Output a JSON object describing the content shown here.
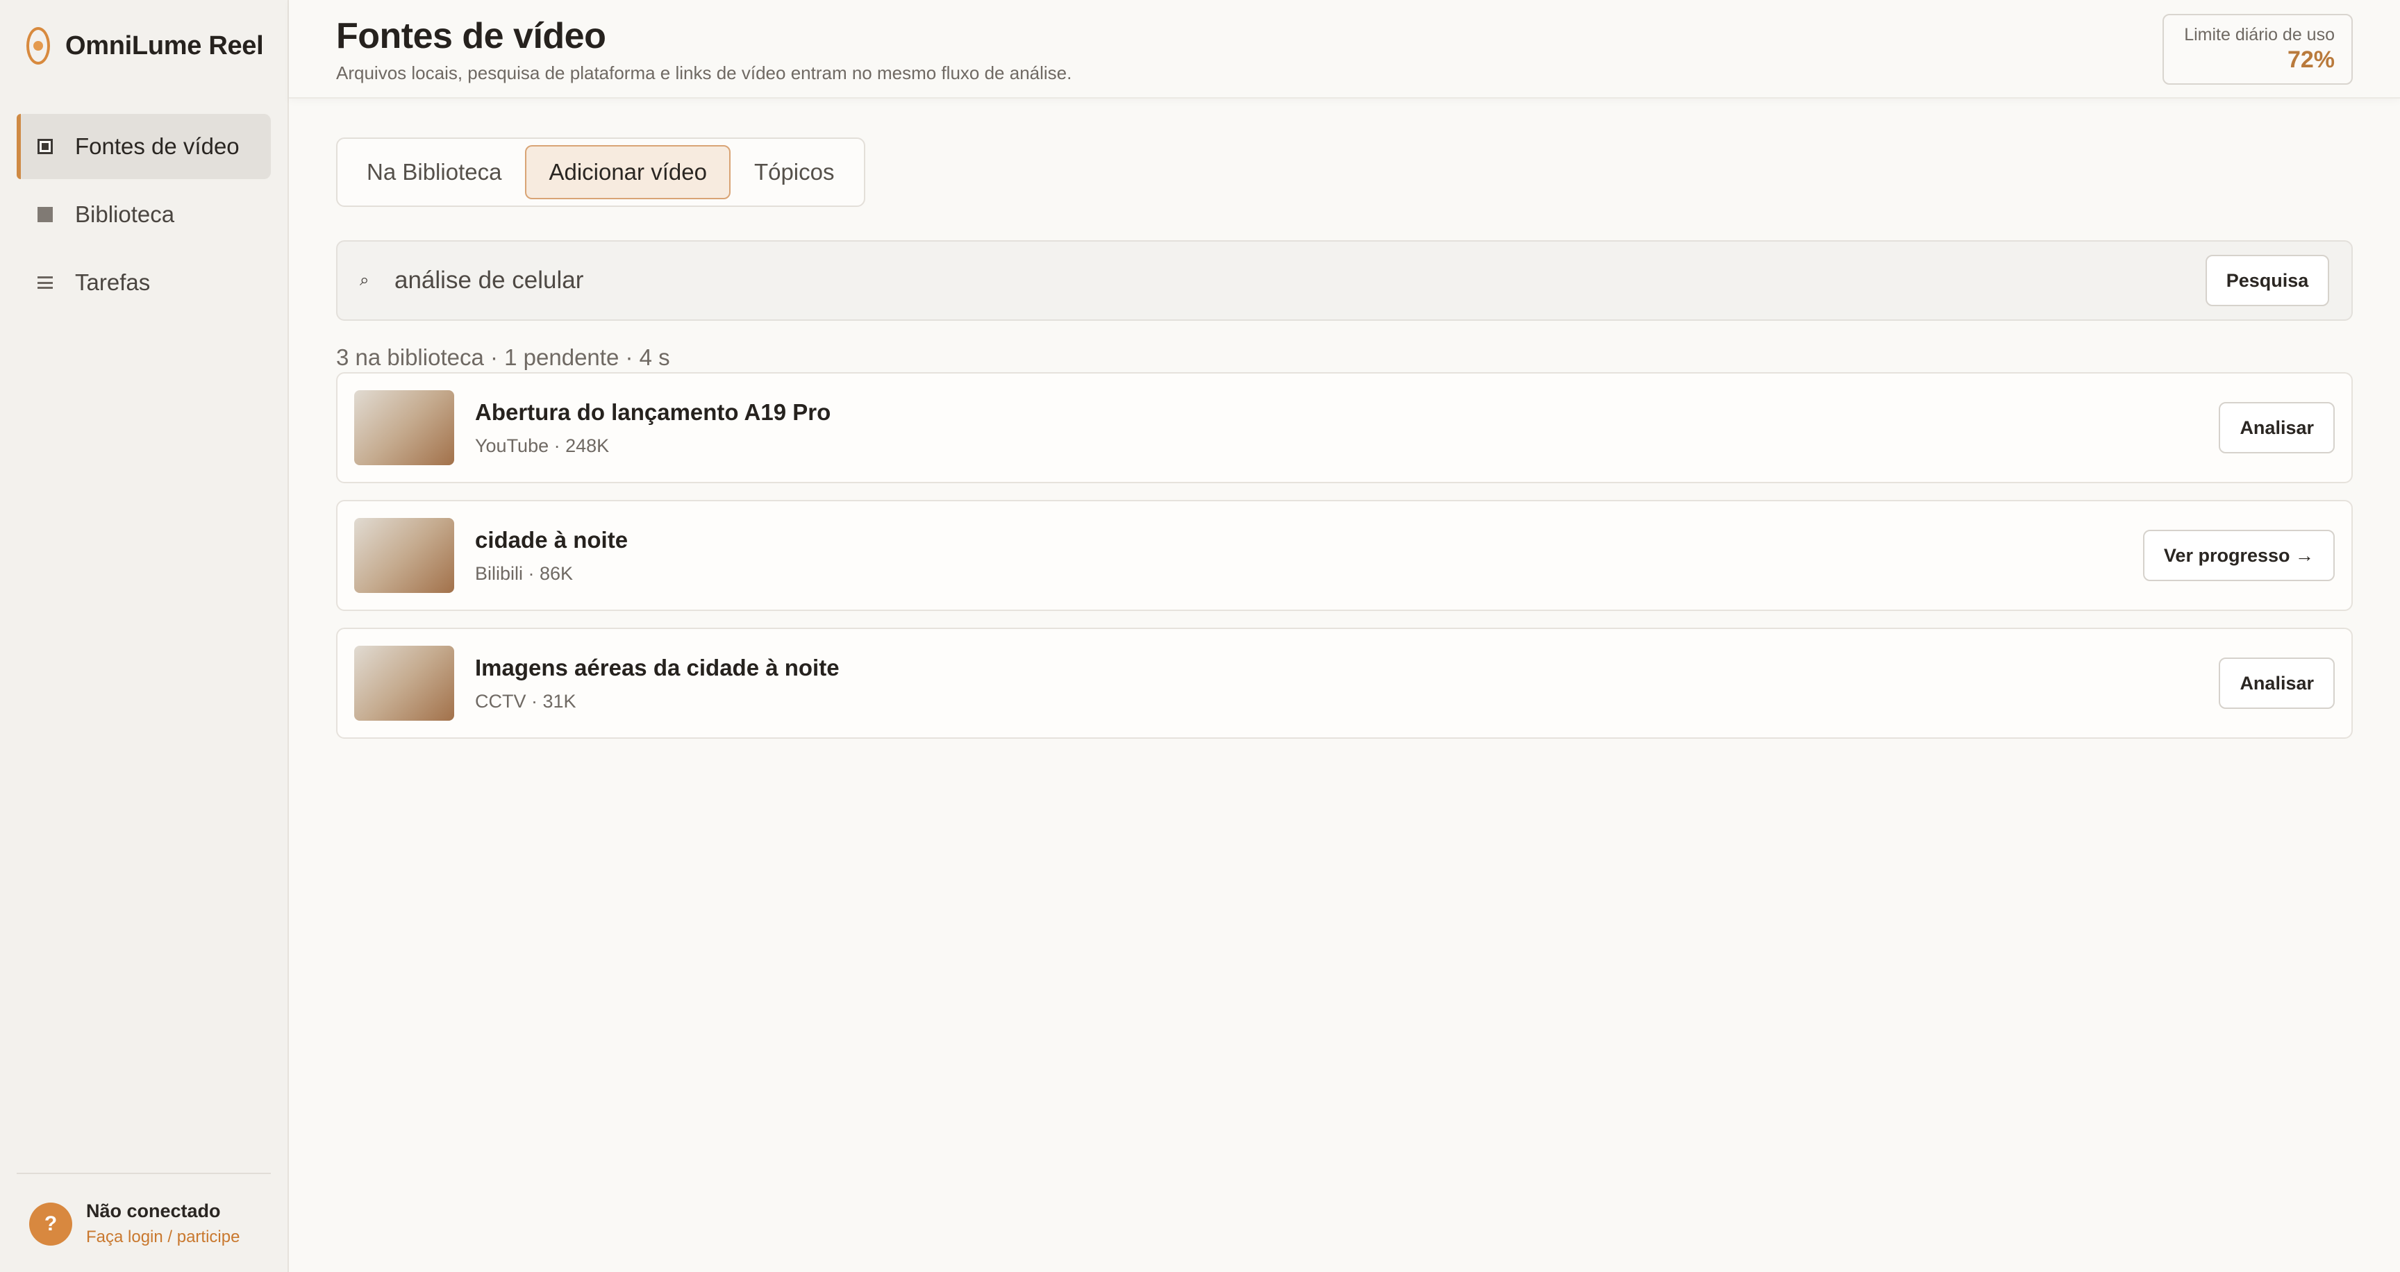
{
  "brand": {
    "name": "OmniLume Reel"
  },
  "sidebar": {
    "items": [
      {
        "label": "Fontes de vídeo",
        "icon": "video-source-icon",
        "active": true
      },
      {
        "label": "Biblioteca",
        "icon": "library-icon",
        "active": false
      },
      {
        "label": "Tarefas",
        "icon": "tasks-icon",
        "active": false
      }
    ],
    "account": {
      "avatar": "?",
      "status": "Não conectado",
      "login_link": "Faça login / participe"
    }
  },
  "header": {
    "title": "Fontes de vídeo",
    "subtitle": "Arquivos locais, pesquisa de plataforma e links de vídeo entram no mesmo fluxo de análise.",
    "usage_label": "Limite diário de uso",
    "usage_value": "72%"
  },
  "tabs": [
    {
      "label": "Na Biblioteca",
      "active": false
    },
    {
      "label": "Adicionar vídeo",
      "active": true
    },
    {
      "label": "Tópicos",
      "active": false
    }
  ],
  "search": {
    "icon": "⌕",
    "value": "análise de celular",
    "button_label": "Pesquisa"
  },
  "results": {
    "summary": "3 na biblioteca · 1 pendente · 4 s",
    "items": [
      {
        "title": "Abertura do lançamento A19 Pro",
        "meta": "YouTube · 248K",
        "action": "Analisar"
      },
      {
        "title": "cidade à noite",
        "meta": "Bilibili · 86K",
        "action": "Ver progresso →"
      },
      {
        "title": "Imagens aéreas da cidade à noite",
        "meta": "CCTV · 31K",
        "action": "Analisar"
      }
    ]
  },
  "colors": {
    "accent": "#d8883f",
    "usage_value": "#b97a3c",
    "active_tab_bg": "#f7ebdf"
  }
}
